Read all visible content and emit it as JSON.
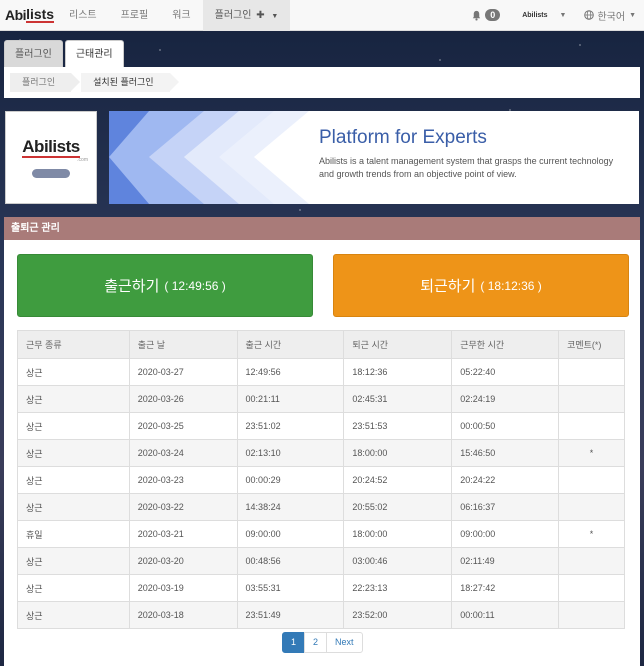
{
  "brand": {
    "abi": "Abi",
    "lists": "lists"
  },
  "nav": {
    "items": [
      "리스트",
      "프로필",
      "워크"
    ],
    "active": "플러그인",
    "bell_count": "0",
    "user_logo": "Abilists",
    "language": "한국어"
  },
  "tabs": [
    "플러그인",
    "근태관리"
  ],
  "breadcrumb": [
    "플러그인",
    "설치된 플러그인"
  ],
  "hero": {
    "logo_abi": "Abi",
    "logo_lists": "lists",
    "logo_sub": ".com",
    "title": "Platform for Experts",
    "description": "Abilists is a talent management system that grasps the current technology and growth trends from an objective point of view."
  },
  "panel": {
    "title": "출퇴근 관리",
    "check_in_label": "출근하기",
    "check_in_time": "( 12:49:56 )",
    "check_out_label": "퇴근하기",
    "check_out_time": "( 18:12:36 )"
  },
  "table": {
    "headers": [
      "근무 종류",
      "출근 날",
      "출근 시간",
      "퇴근 시간",
      "근무한 시간",
      "코멘트(*)"
    ],
    "rows": [
      [
        "상근",
        "2020-03-27",
        "12:49:56",
        "18:12:36",
        "05:22:40",
        ""
      ],
      [
        "상근",
        "2020-03-26",
        "00:21:11",
        "02:45:31",
        "02:24:19",
        ""
      ],
      [
        "상근",
        "2020-03-25",
        "23:51:02",
        "23:51:53",
        "00:00:50",
        ""
      ],
      [
        "상근",
        "2020-03-24",
        "02:13:10",
        "18:00:00",
        "15:46:50",
        "*"
      ],
      [
        "상근",
        "2020-03-23",
        "00:00:29",
        "20:24:52",
        "20:24:22",
        ""
      ],
      [
        "상근",
        "2020-03-22",
        "14:38:24",
        "20:55:02",
        "06:16:37",
        ""
      ],
      [
        "휴일",
        "2020-03-21",
        "09:00:00",
        "18:00:00",
        "09:00:00",
        "*"
      ],
      [
        "상근",
        "2020-03-20",
        "00:48:56",
        "03:00:46",
        "02:11:49",
        ""
      ],
      [
        "상근",
        "2020-03-19",
        "03:55:31",
        "22:23:13",
        "18:27:42",
        ""
      ],
      [
        "상근",
        "2020-03-18",
        "23:51:49",
        "23:52:00",
        "00:00:11",
        ""
      ]
    ]
  },
  "pagination": {
    "pages": [
      "1",
      "2"
    ],
    "next": "Next",
    "current": "1"
  },
  "colors": {
    "check_in": "#3f9c3f",
    "check_out": "#ee9418",
    "panel_head": "#a97b79",
    "link": "#337ab7"
  }
}
